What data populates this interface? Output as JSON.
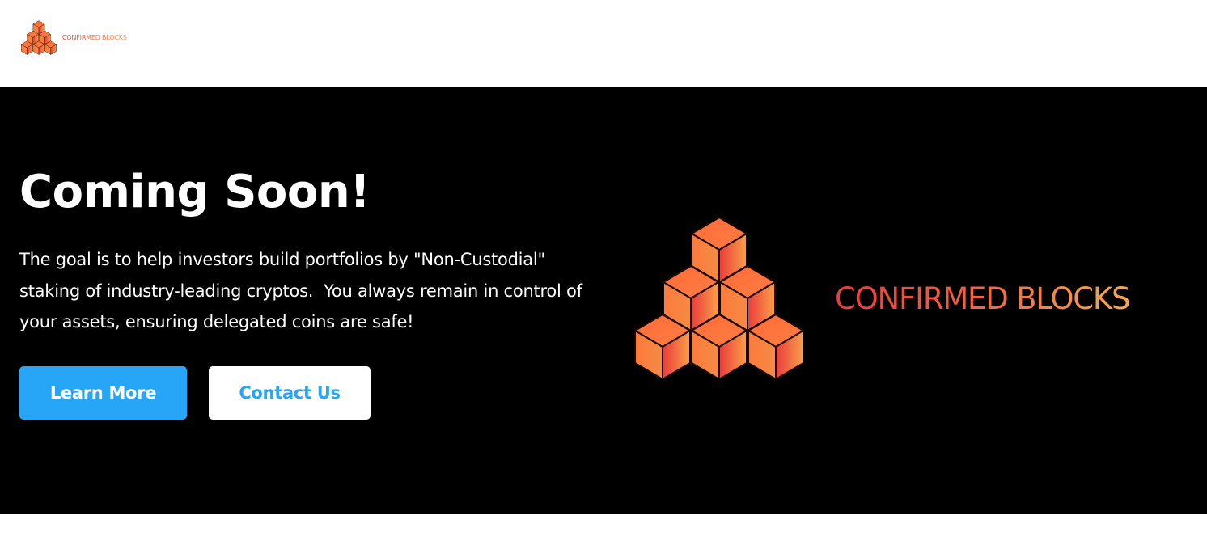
{
  "header": {
    "logo_text": "CONFIRMED BLOCKS",
    "logo_icon": "stacked-cubes-logo"
  },
  "hero": {
    "title": "Coming Soon!",
    "description": "The goal is to help investors build portfolios by \"Non-Custodial\" staking of industry-leading cryptos.  You always remain in control of your assets, ensuring delegated coins are safe!",
    "primary_button": "Learn More",
    "secondary_button": "Contact Us",
    "logo_text": "CONFIRMED BLOCKS",
    "logo_icon": "stacked-cubes-logo"
  },
  "colors": {
    "hero_background": "#000000",
    "accent_blue": "#27a6f7",
    "logo_gradient_start": "#ea3b3c",
    "logo_gradient_end": "#f8a752"
  }
}
